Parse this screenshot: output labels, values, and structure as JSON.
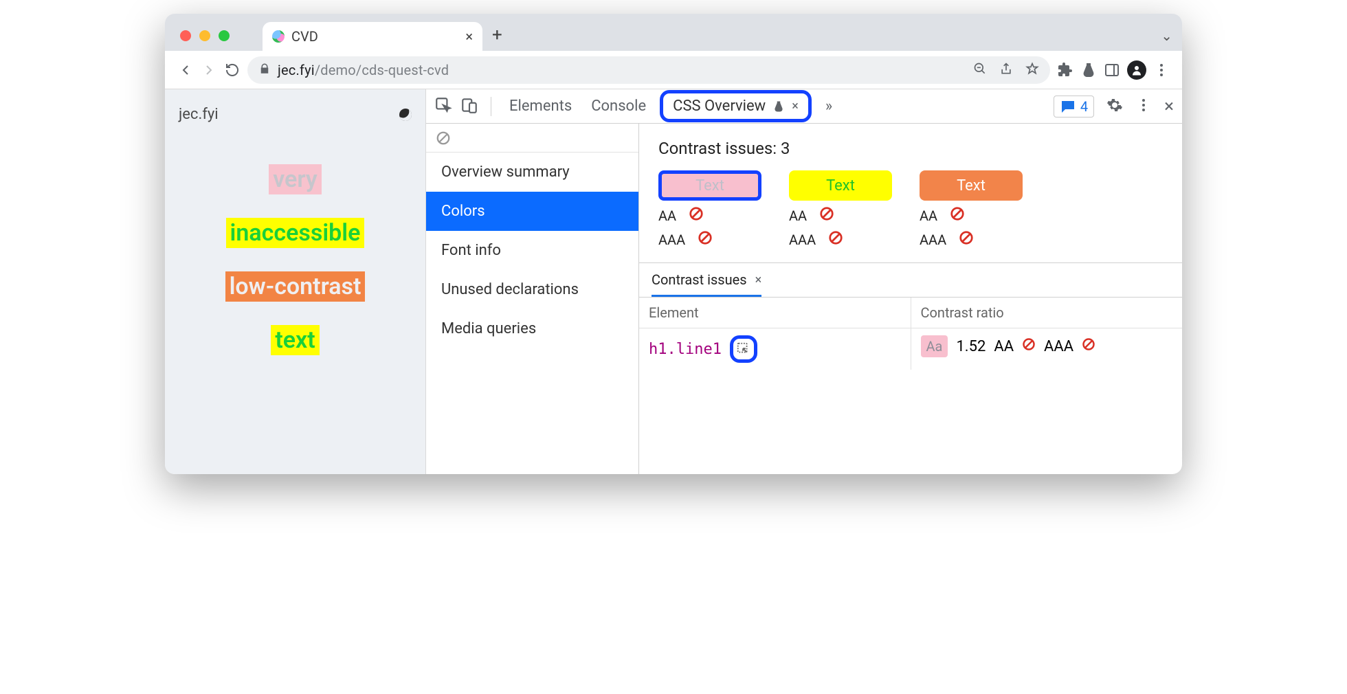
{
  "browser": {
    "tab_title": "CVD",
    "url_host": "jec.fyi",
    "url_path": "/demo/cds-quest-cvd"
  },
  "page": {
    "site_label": "jec.fyi",
    "words": [
      "very",
      "inaccessible",
      "low-contrast",
      "text"
    ]
  },
  "devtools": {
    "tabs": [
      "Elements",
      "Console",
      "CSS Overview"
    ],
    "active_tab": "CSS Overview",
    "issues_badge_count": "4",
    "overview": {
      "sections": [
        "Overview summary",
        "Colors",
        "Font info",
        "Unused declarations",
        "Media queries"
      ],
      "active_section": "Colors"
    },
    "contrast": {
      "title_prefix": "Contrast issues: ",
      "count": "3",
      "swatch_label": "Text",
      "levels": [
        "AA",
        "AAA"
      ],
      "subtab_label": "Contrast issues",
      "table": {
        "col_element": "Element",
        "col_ratio": "Contrast ratio",
        "row": {
          "element": "h1.line1",
          "sample": "Aa",
          "ratio": "1.52",
          "aa": "AA",
          "aaa": "AAA"
        }
      }
    }
  }
}
